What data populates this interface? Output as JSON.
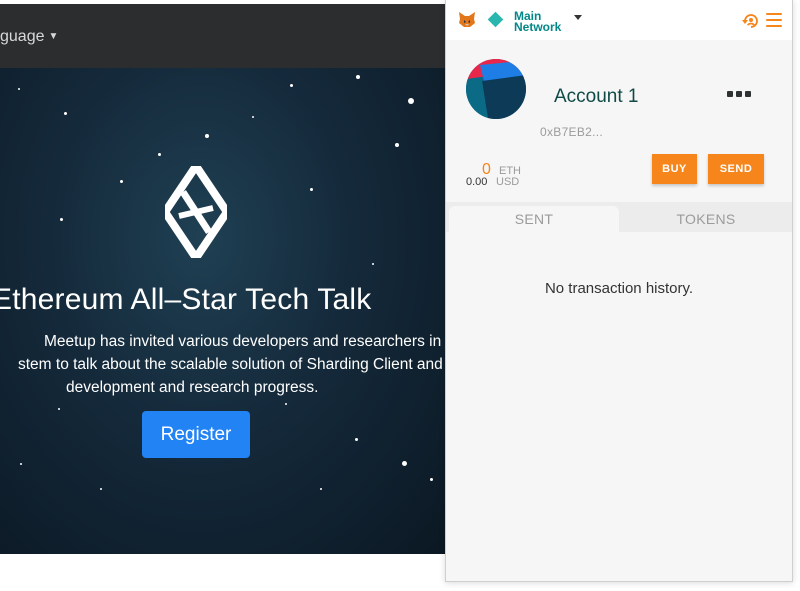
{
  "site": {
    "nav": {
      "language_label": "guage"
    },
    "hero": {
      "title": "Ethereum All–Star Tech Talk",
      "description_lines": [
        "Meetup has invited various developers and researchers in the",
        "stem to talk about the scalable solution of Sharding Client and",
        "development and research progress."
      ],
      "register_label": "Register"
    }
  },
  "popup": {
    "network": {
      "line1": "Main",
      "line2": "Network"
    },
    "account": {
      "name": "Account 1",
      "address": "0xB7EB2..."
    },
    "balance": {
      "eth_value": "0",
      "eth_unit": "ETH",
      "usd_value": "0.00",
      "usd_unit": "USD"
    },
    "buttons": {
      "buy": "BUY",
      "send": "SEND"
    },
    "tabs": [
      {
        "label": "SENT"
      },
      {
        "label": "TOKENS"
      }
    ],
    "empty_message": "No transaction history."
  },
  "colors": {
    "accent_orange": "#f6851b",
    "network_teal": "#29b6af",
    "register_blue": "#2183f4"
  },
  "icons": [
    "metamask-fox-icon",
    "network-status-icon",
    "sync-icon",
    "hamburger-menu-icon",
    "more-options-icon",
    "hero-logo-icon"
  ]
}
